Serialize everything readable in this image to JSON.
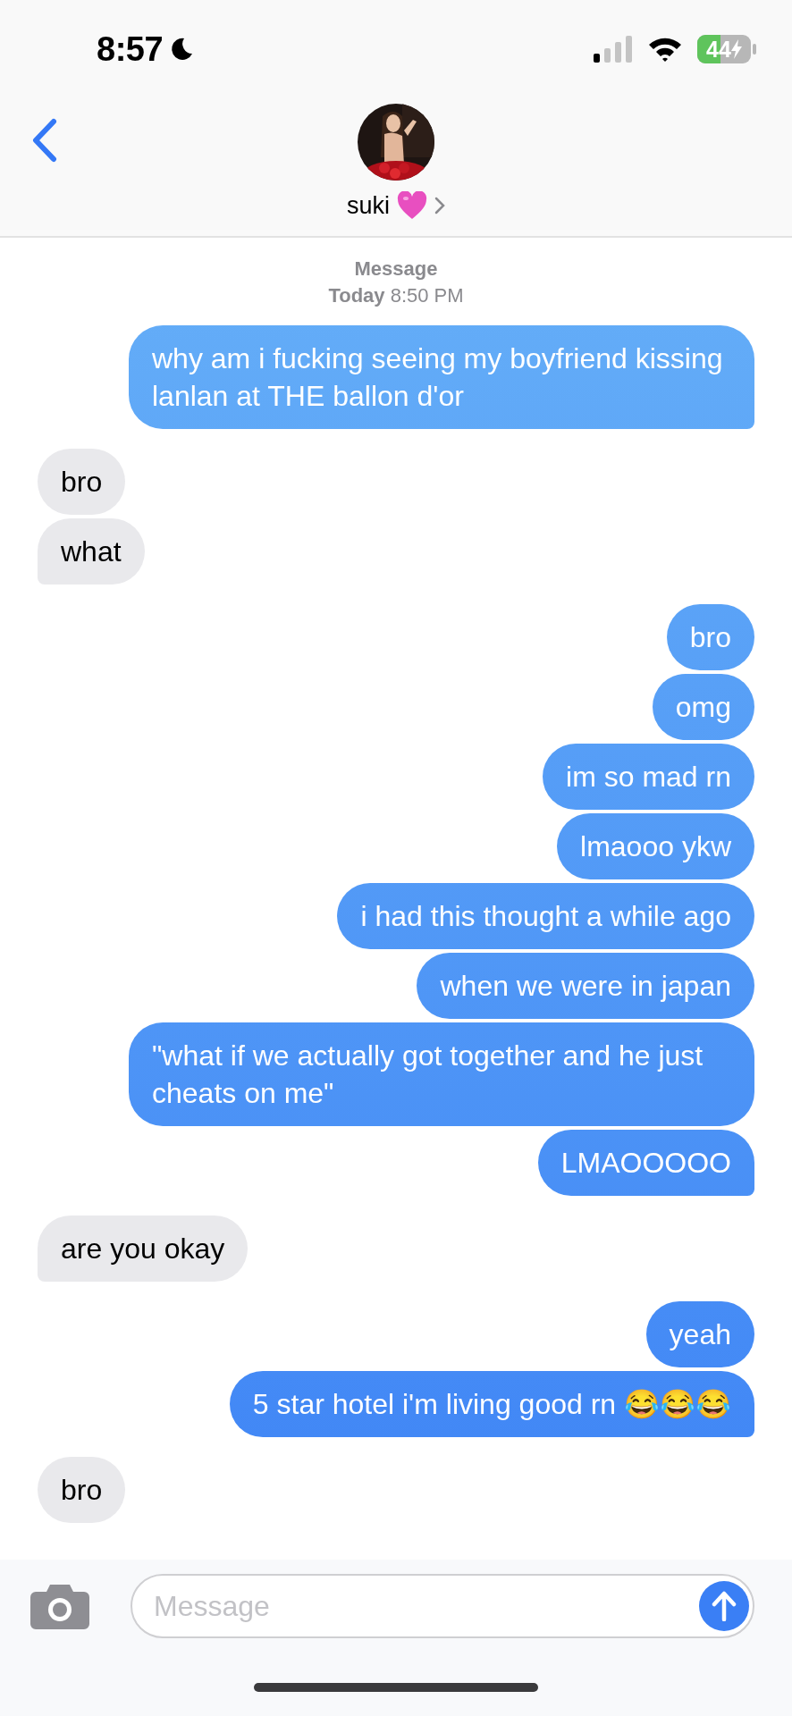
{
  "status_bar": {
    "time": "8:57",
    "battery": "44"
  },
  "header": {
    "contact": "suki"
  },
  "thread_label": {
    "service": "Message",
    "day": "Today",
    "time": "8:50 PM"
  },
  "messages": [
    {
      "kind": "sent",
      "text": "why am i fucking seeing my boyfriend kissing lanlan at THE ballon d'or",
      "tail": true
    },
    {
      "kind": "received",
      "text": "bro",
      "tail": false
    },
    {
      "kind": "received",
      "text": "what",
      "tail": true
    },
    {
      "kind": "sent",
      "text": "bro",
      "tail": false
    },
    {
      "kind": "sent",
      "text": "omg",
      "tail": false
    },
    {
      "kind": "sent",
      "text": "im so mad rn",
      "tail": false
    },
    {
      "kind": "sent",
      "text": "lmaooo ykw",
      "tail": false
    },
    {
      "kind": "sent",
      "text": "i had this thought a while ago",
      "tail": false
    },
    {
      "kind": "sent",
      "text": "when we were in japan",
      "tail": false
    },
    {
      "kind": "sent",
      "text": "\"what if we actually got together and he just cheats on me\"",
      "tail": false
    },
    {
      "kind": "sent",
      "text": "LMAOOOOO",
      "tail": true
    },
    {
      "kind": "received",
      "text": "are you okay",
      "tail": true
    },
    {
      "kind": "sent",
      "text": "yeah",
      "tail": false
    },
    {
      "kind": "sent",
      "text": "5 star hotel i'm living good rn 😂😂😂",
      "tail": true
    },
    {
      "kind": "received",
      "text": "bro",
      "tail": false
    }
  ],
  "compose": {
    "placeholder": "Message"
  }
}
